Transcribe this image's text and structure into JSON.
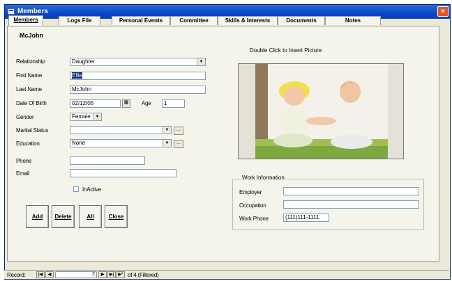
{
  "window": {
    "title": "Members",
    "close_glyph": "×"
  },
  "tabs": [
    "Members",
    "Logs File",
    "Personal Events",
    "Committee",
    "Skills & Interests",
    "Documents",
    "Notes"
  ],
  "member_heading": "McJohn",
  "form": {
    "relationship_label": "Relationship",
    "relationship_value": "Daughter",
    "first_name_label": "First Name",
    "first_name_value": "Ellie",
    "last_name_label": "Last Name",
    "last_name_value": "McJohn",
    "dob_label": "Date Of Birth",
    "dob_value": "02/12/05",
    "age_label": "Age",
    "age_value": "1",
    "gender_label": "Gender",
    "gender_value": "Female",
    "marital_label": "Marital Status",
    "marital_value": "",
    "education_label": "Education",
    "education_value": "None",
    "phone_label": "Phone",
    "phone_value": "",
    "email_label": "Email",
    "email_value": "",
    "inactive_label": "InActive",
    "ellipsis": "..."
  },
  "buttons": {
    "add": "Add",
    "delete": "Delete",
    "all": "All",
    "close": "Close"
  },
  "picture": {
    "hint": "Double Click to Insert Picture"
  },
  "work": {
    "group_title": "Work Information",
    "employer_label": "Employer",
    "employer_value": "",
    "occupation_label": "Occupation",
    "occupation_value": "",
    "work_phone_label": "Work Phone",
    "work_phone_value": "(111)111-1111"
  },
  "nav": {
    "record_label": "Record:",
    "current": "2",
    "of_text": "of 4 (Filtered)"
  },
  "icons": {
    "title": "form-icon",
    "calendar": "calendar-icon",
    "dropdown": "dropdown-arrow-icon"
  }
}
